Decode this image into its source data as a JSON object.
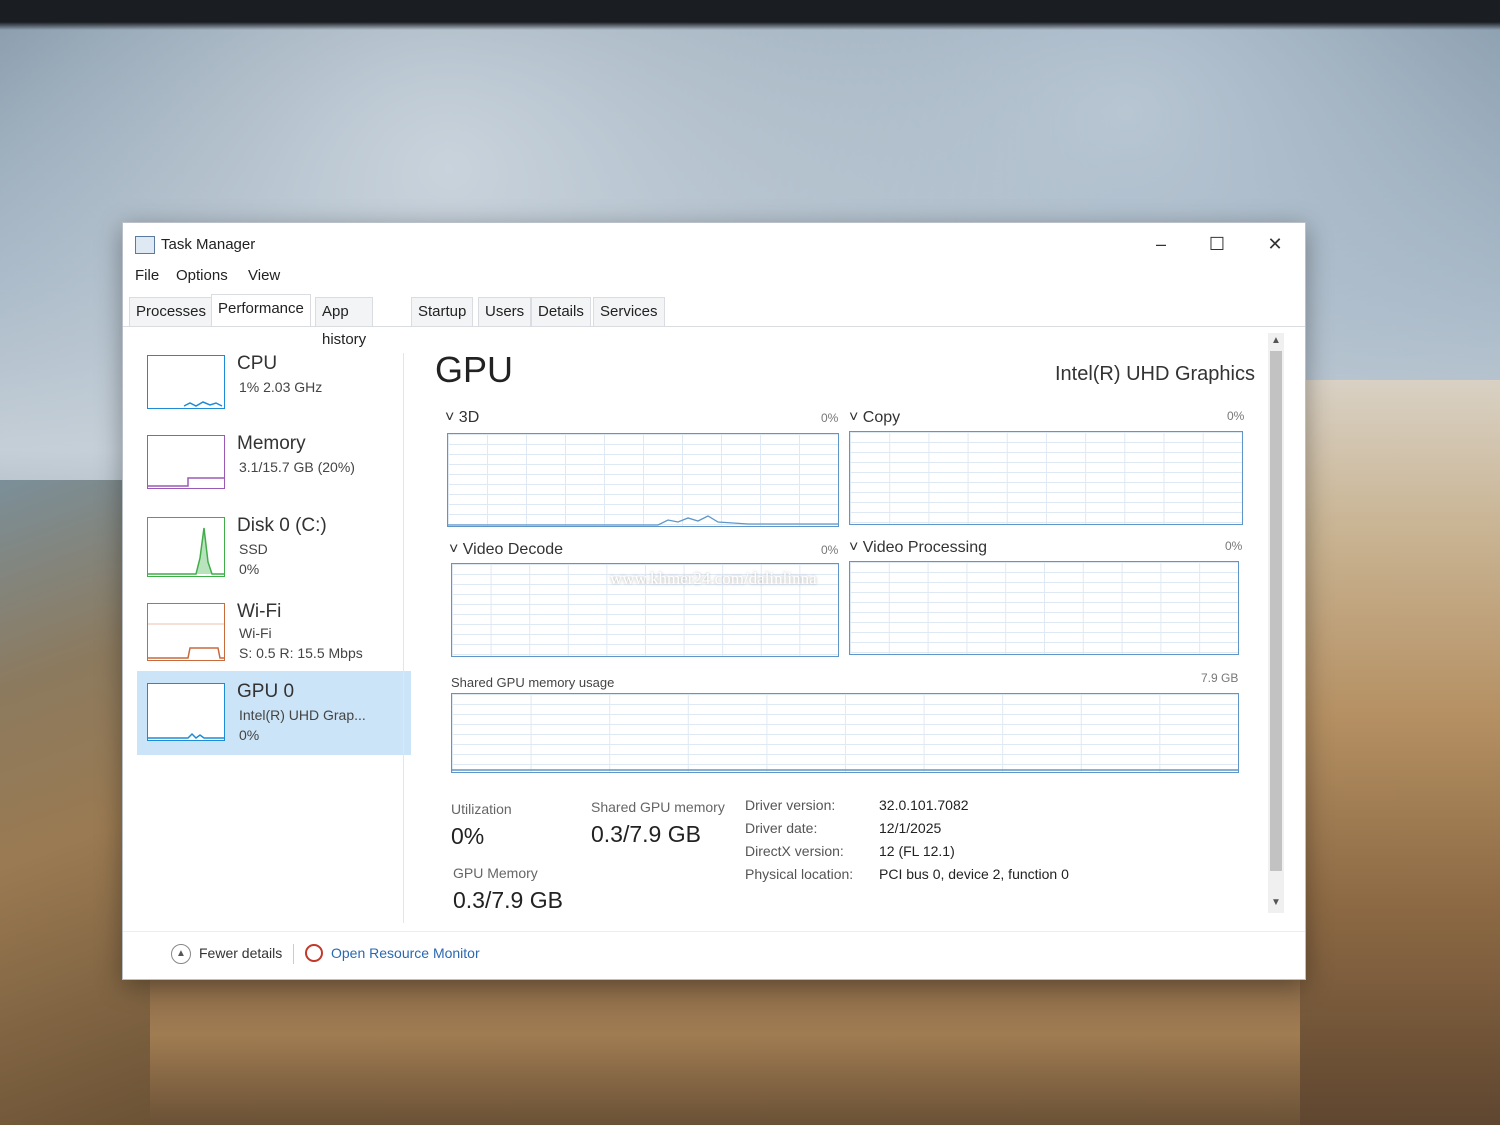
{
  "window": {
    "title": "Task Manager",
    "controls": {
      "minimize": "–",
      "maximize": "☐",
      "close": "✕"
    }
  },
  "menu": [
    "File",
    "Options",
    "View"
  ],
  "tabs": [
    "Processes",
    "Performance",
    "App history",
    "Startup",
    "Users",
    "Details",
    "Services"
  ],
  "active_tab": "Performance",
  "sidebar": [
    {
      "title": "CPU",
      "lines": [
        "1%  2.03 GHz"
      ],
      "color": "#1e8bd6"
    },
    {
      "title": "Memory",
      "lines": [
        "3.1/15.7 GB (20%)"
      ],
      "color": "#9b59b6"
    },
    {
      "title": "Disk 0 (C:)",
      "lines": [
        "SSD",
        "0%"
      ],
      "color": "#3fae49"
    },
    {
      "title": "Wi-Fi",
      "lines": [
        "Wi-Fi",
        "S: 0.5  R: 15.5 Mbps"
      ],
      "color": "#c76a3c"
    },
    {
      "title": "GPU 0",
      "lines": [
        "Intel(R) UHD Grap...",
        "0%"
      ],
      "color": "#1e8bd6",
      "selected": true
    }
  ],
  "main": {
    "title": "GPU",
    "model": "Intel(R) UHD Graphics",
    "graphs": [
      {
        "label": "3D",
        "pct": "0%"
      },
      {
        "label": "Copy",
        "pct": "0%"
      },
      {
        "label": "Video Decode",
        "pct": "0%"
      },
      {
        "label": "Video Processing",
        "pct": "0%"
      }
    ],
    "shared_memory": {
      "label": "Shared GPU memory usage",
      "max": "7.9 GB"
    },
    "stats": {
      "utilization_label": "Utilization",
      "utilization_value": "0%",
      "shared_label": "Shared GPU memory",
      "shared_value": "0.3/7.9 GB",
      "gpu_memory_label": "GPU Memory",
      "gpu_memory_value": "0.3/7.9 GB"
    },
    "info": [
      {
        "key": "Driver version:",
        "value": "32.0.101.7082"
      },
      {
        "key": "Driver date:",
        "value": "12/1/2025"
      },
      {
        "key": "DirectX version:",
        "value": "12 (FL 12.1)"
      },
      {
        "key": "Physical location:",
        "value": "PCI bus 0, device 2, function 0"
      }
    ]
  },
  "footer": {
    "fewer": "Fewer details",
    "resource_monitor": "Open Resource Monitor"
  },
  "watermark": "www.khmer24.com/dalinlinna",
  "colors": {
    "accent": "#5f96c9",
    "selected": "#cce4f7",
    "link": "#2b68b4"
  }
}
